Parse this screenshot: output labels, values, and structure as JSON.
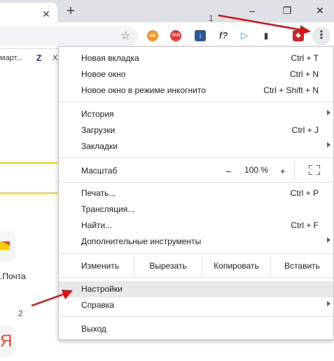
{
  "titlebar": {
    "tab_close": "✕",
    "new_tab": "+",
    "minimize": "–",
    "restore": "❐",
    "close": "✕"
  },
  "toolbar": {
    "star": "☆",
    "ext_ok": "ok",
    "ext_yab": "YAB",
    "ext_dl": "↓",
    "ext_f": "f?",
    "ext_play": "▷",
    "ext_bars": "▮",
    "ext_red": "◆",
    "menu": "⋮"
  },
  "bookmarks": {
    "item1": "март...",
    "item2": "Z",
    "item3": "Х"
  },
  "page": {
    "mail_label": ".Почта",
    "ya_glyph": "Я"
  },
  "menu": {
    "new_tab": "Новая вкладка",
    "new_tab_sc": "Ctrl + T",
    "new_window": "Новое окно",
    "new_window_sc": "Ctrl + N",
    "incognito": "Новое окно в режиме инкогнито",
    "incognito_sc": "Ctrl + Shift + N",
    "history": "История",
    "downloads": "Загрузки",
    "downloads_sc": "Ctrl + J",
    "bookmarks": "Закладки",
    "zoom": "Масштаб",
    "zoom_minus": "–",
    "zoom_value": "100 %",
    "zoom_plus": "+",
    "print": "Печать...",
    "print_sc": "Ctrl + P",
    "cast": "Трансляция...",
    "find": "Найти...",
    "find_sc": "Ctrl + F",
    "more_tools": "Дополнительные инструменты",
    "edit": "Изменить",
    "cut": "Вырезать",
    "copy": "Копировать",
    "paste": "Вставить",
    "settings": "Настройки",
    "help": "Справка",
    "exit": "Выход"
  },
  "annotations": {
    "label1": "1",
    "label2": "2",
    "color": "#d51212"
  }
}
